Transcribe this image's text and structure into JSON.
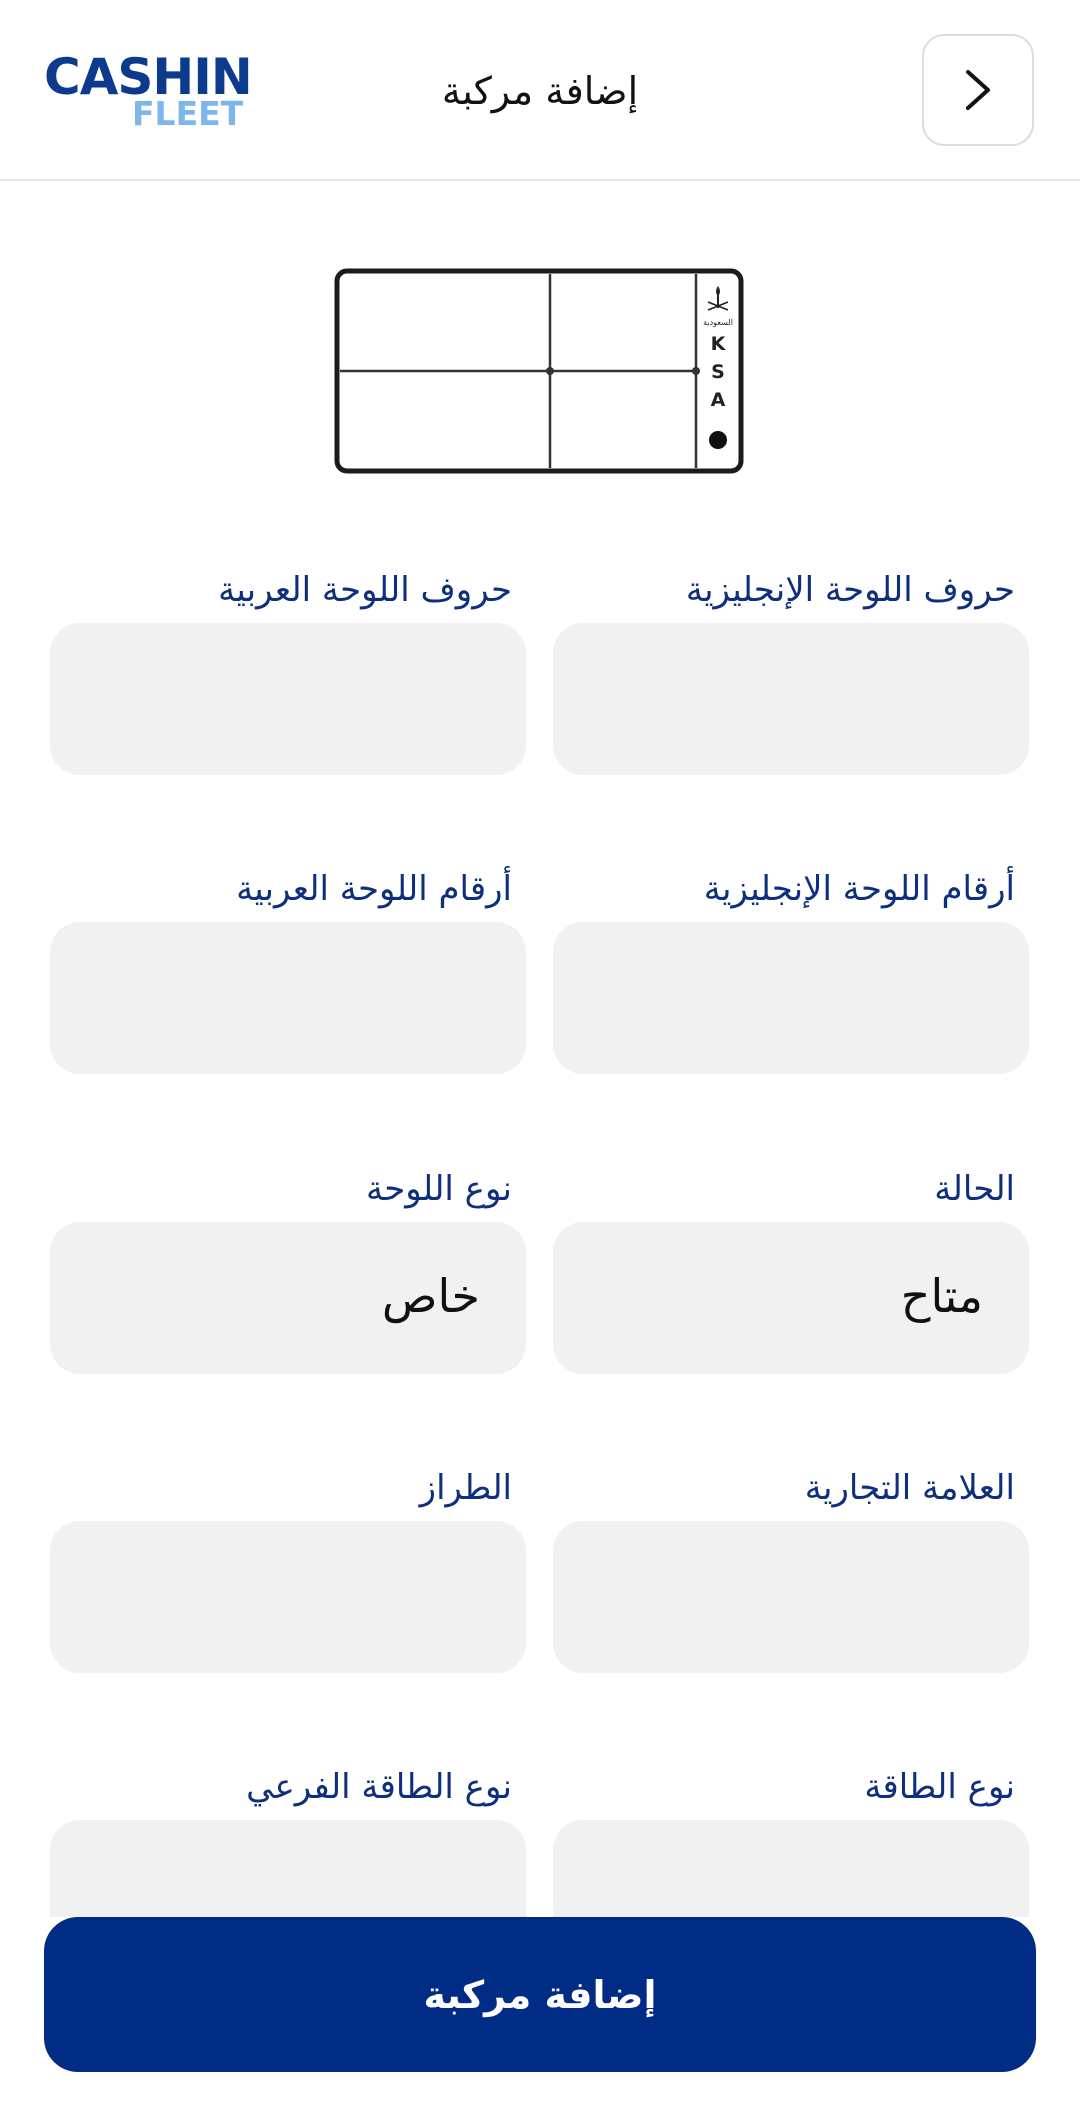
{
  "header": {
    "logo_top": "CASHIN",
    "logo_bottom": "FLEET",
    "title": "إضافة مركبة",
    "back_icon": "chevron-right-icon"
  },
  "plate": {
    "country_label": "السعودية",
    "letters": [
      "K",
      "S",
      "A"
    ]
  },
  "form": {
    "english_letters_label": "حروف اللوحة الإنجليزية",
    "arabic_letters_label": "حروف اللوحة العربية",
    "english_numbers_label": "أرقام اللوحة الإنجليزية",
    "arabic_numbers_label": "أرقام اللوحة العربية",
    "status_label": "الحالة",
    "status_value": "متاح",
    "plate_type_label": "نوع اللوحة",
    "plate_type_value": "خاص",
    "brand_label": "العلامة التجارية",
    "model_label": "الطراز",
    "energy_type_label": "نوع الطاقة",
    "energy_subtype_label": "نوع الطاقة الفرعي"
  },
  "actions": {
    "submit_label": "إضافة مركبة"
  },
  "colors": {
    "primary": "#002c86",
    "label": "#0d2f7d",
    "field_bg": "#f1f1f2",
    "logo_dark": "#0c3a8c",
    "logo_light": "#7cb6ea"
  }
}
